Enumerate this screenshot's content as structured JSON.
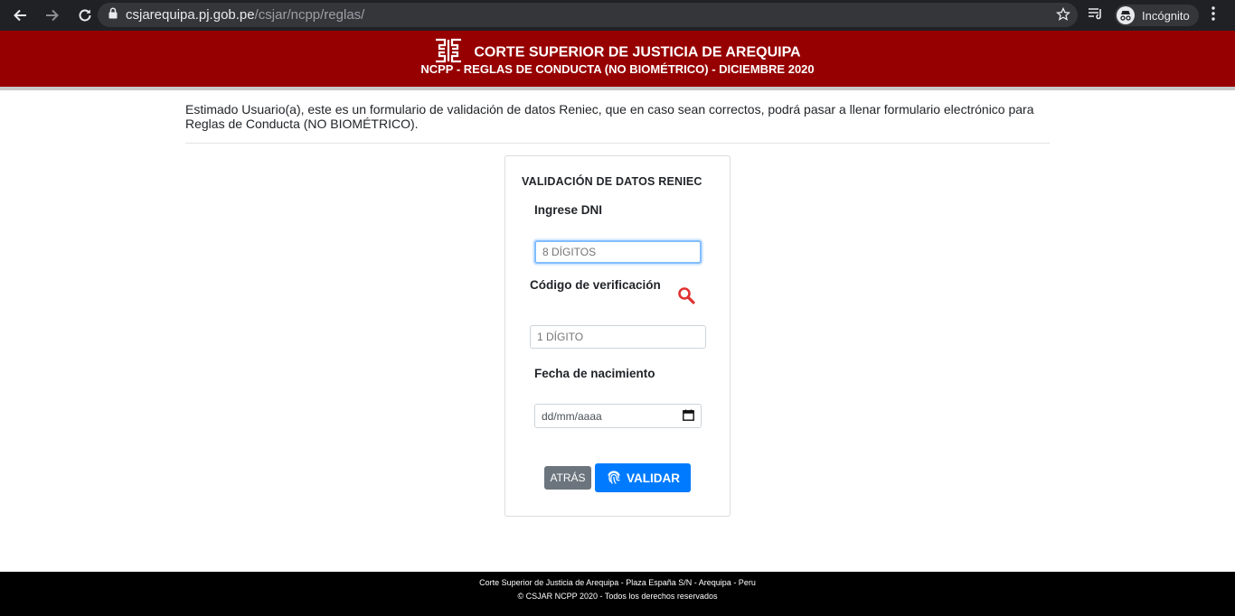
{
  "browser": {
    "url_domain": "csjarequipa.pj.gob.pe",
    "url_path": "/csjar/ncpp/reglas/",
    "incognito_label": "Incógnito"
  },
  "header": {
    "title": "CORTE SUPERIOR DE JUSTICIA DE AREQUIPA",
    "subtitle": "NCPP - REGLAS DE CONDUCTA (NO BIOMÉTRICO) - DICIEMBRE 2020"
  },
  "intro": {
    "text": "Estimado Usuario(a), este es un formulario de validación de datos Reniec, que en caso sean correctos, podrá pasar a llenar formulario electrónico para Reglas de Conducta (NO BIOMÉTRICO)."
  },
  "form": {
    "title": "VALIDACIÓN DE DATOS RENIEC",
    "dni_label": "Ingrese DNI",
    "dni_placeholder": "8 DÍGITOS",
    "dni_value": "",
    "code_label": "Código de verificación",
    "code_placeholder": "1 DÍGITO",
    "code_value": "",
    "birth_label": "Fecha de nacimiento",
    "birth_placeholder": "dd/mm/aaaa",
    "back_label": "ATRÁS",
    "validate_label": "VALIDAR"
  },
  "footer": {
    "line1": "Corte Superior de Justicia de Arequipa - Plaza España S/N - Arequipa - Peru",
    "line2": "© CSJAR NCPP 2020 - Todos los derechos reservados"
  },
  "colors": {
    "banner": "#970000",
    "primary_button": "#007bff",
    "secondary_button": "#6c757d",
    "search_icon": "#e03131"
  }
}
